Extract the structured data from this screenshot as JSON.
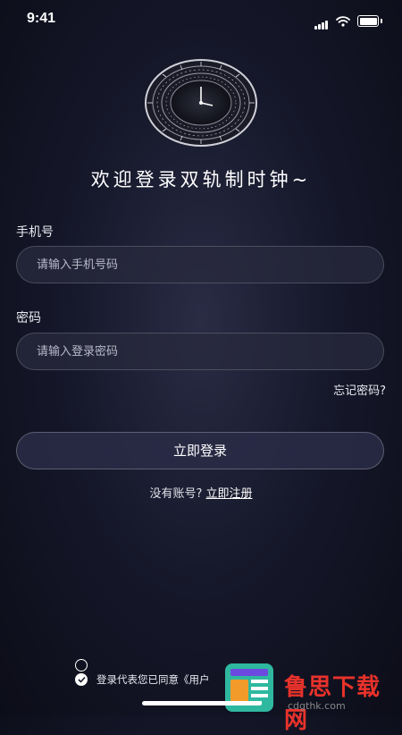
{
  "status_bar": {
    "time": "9:41"
  },
  "headline": "欢迎登录双轨制时钟~",
  "phone": {
    "label": "手机号",
    "placeholder": "请输入手机号码"
  },
  "password": {
    "label": "密码",
    "placeholder": "请输入登录密码"
  },
  "forgot_label": "忘记密码?",
  "login_label": "立即登录",
  "register": {
    "prompt": "没有账号?",
    "link": "立即注册"
  },
  "agreement": {
    "text": "登录代表您已同意《用户"
  },
  "watermark": {
    "text": "鲁思下载网",
    "url": "cdgthk.com"
  },
  "colors": {
    "background": "#16182b",
    "watermark_red": "#e8322b"
  }
}
